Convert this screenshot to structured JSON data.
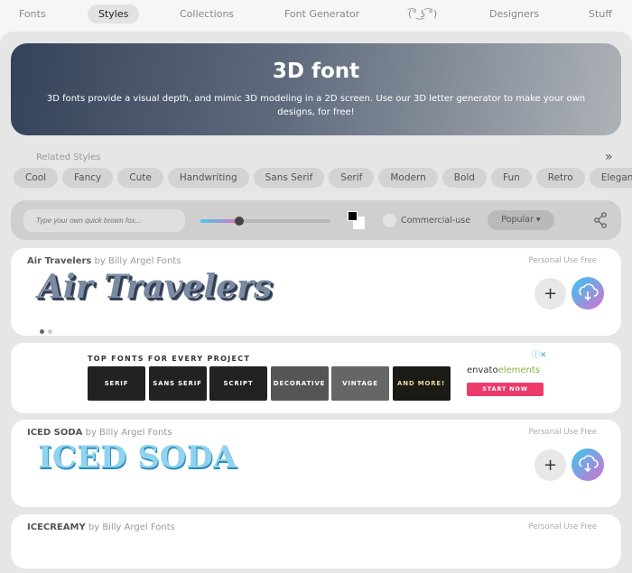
{
  "nav": {
    "items": [
      "Fonts",
      "Styles",
      "Collections",
      "Font Generator",
      "(͡° ͜ʖ ͡°)",
      "Designers",
      "Stuff"
    ],
    "active": "Styles"
  },
  "hero": {
    "title": "3D font",
    "description": "3D fonts provide a visual depth, and mimic 3D modeling in a 2D screen. Use our 3D letter generator to make your own designs, for free!"
  },
  "related": {
    "label": "Related Styles",
    "chips": [
      "Cool",
      "Fancy",
      "Cute",
      "Handwriting",
      "Sans Serif",
      "Serif",
      "Modern",
      "Bold",
      "Fun",
      "Retro",
      "Elegant"
    ]
  },
  "toolbar": {
    "placeholder": "Type your own quick brown fox...",
    "size_fraction": 0.3,
    "fg_color": "#000000",
    "bg_color": "#ffffff",
    "commercial_label": "Commercial-use",
    "sort_label": "Popular ▾"
  },
  "fonts": [
    {
      "name": "Air Travelers",
      "by": " by Billy Argel Fonts",
      "license": "Personal Use Free",
      "preview": "Air Travelers"
    },
    {
      "name": "ICED SODA",
      "by": " by Billy Argel Fonts",
      "license": "Personal Use Free",
      "preview": "ICED SODA"
    },
    {
      "name": "ICECREAMY",
      "by": " by Billy Argel Fonts",
      "license": "Personal Use Free"
    }
  ],
  "ad": {
    "title": "TOP FONTS FOR EVERY PROJECT",
    "tiles": [
      "SERIF",
      "SANS SERIF",
      "SCRIPT",
      "DECORATIVE",
      "VINTAGE",
      "AND MORE!"
    ],
    "brand_a": "envato",
    "brand_b": "elements",
    "cta": "START NOW",
    "close": "ⓘ✕"
  }
}
